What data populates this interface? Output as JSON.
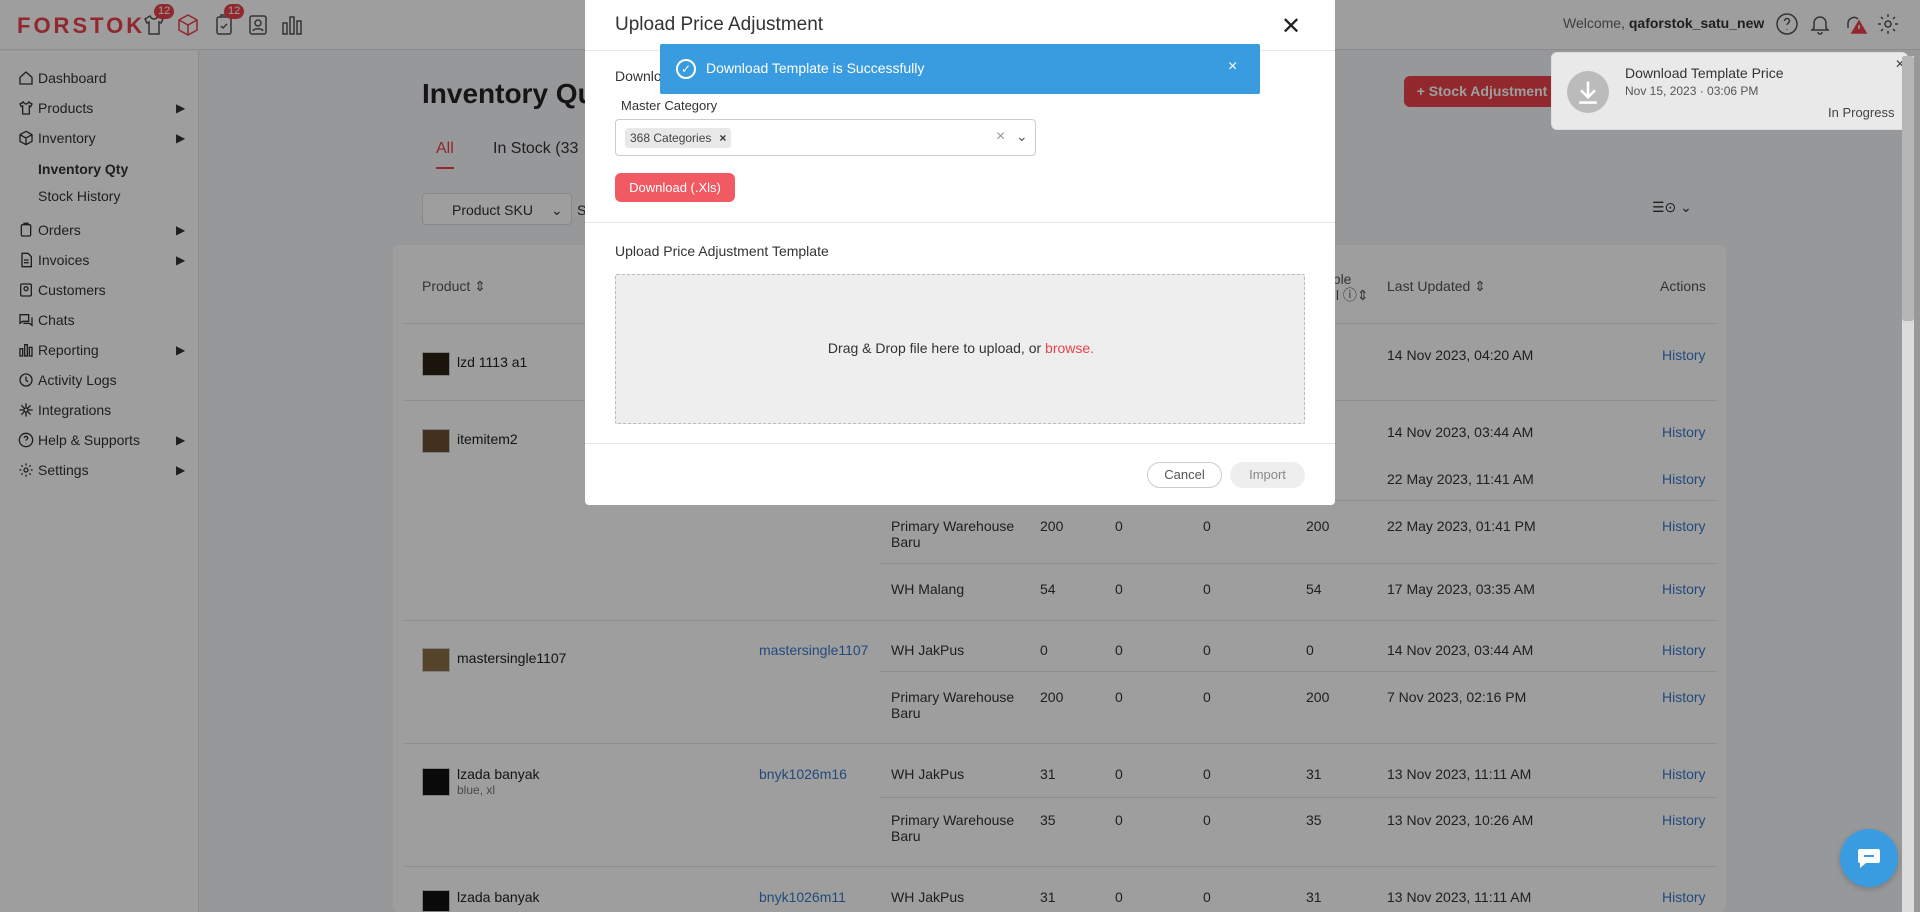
{
  "app": {
    "logo": "FORSTOK",
    "badge_count_1": "12",
    "badge_count_2": "12"
  },
  "header": {
    "welcome": "Welcome,",
    "username": "qaforstok_satu_new"
  },
  "sidebar": {
    "items": [
      {
        "label": "Dashboard",
        "icon": "home-icon"
      },
      {
        "label": "Products",
        "icon": "shirt-icon"
      },
      {
        "label": "Inventory",
        "icon": "box-icon"
      },
      {
        "label": "Orders",
        "icon": "clipboard-icon"
      },
      {
        "label": "Invoices",
        "icon": "document-icon"
      },
      {
        "label": "Customers",
        "icon": "contact-icon"
      },
      {
        "label": "Chats",
        "icon": "chat-icon"
      },
      {
        "label": "Reporting",
        "icon": "bar-chart-icon"
      },
      {
        "label": "Activity Logs",
        "icon": "history-icon"
      },
      {
        "label": "Integrations",
        "icon": "integration-icon"
      },
      {
        "label": "Help & Supports",
        "icon": "help-icon"
      },
      {
        "label": "Settings",
        "icon": "gear-icon"
      }
    ],
    "inventory_sub": [
      "Inventory Qty",
      "Stock History"
    ]
  },
  "page": {
    "title": "Inventory Qu",
    "tabs": [
      "All",
      "In Stock (33"
    ],
    "stock_button": "+ Stock Adjustment",
    "filter_label": "Product SKU",
    "filter_input": "S"
  },
  "table": {
    "headers": {
      "product": "Product ⇕",
      "available_line1": "able",
      "available_line2": "ell",
      "last_updated": "Last Updated ⇕",
      "actions": "Actions"
    },
    "history": "History",
    "rows": [
      {
        "name": "lzd 1113 a1",
        "date": "14 Nov 2023, 04:20 AM"
      },
      {
        "name": "itemitem2",
        "date": "14 Nov 2023, 03:44 AM"
      },
      {
        "date": "22 May 2023, 11:41 AM"
      },
      {
        "wh": "Primary Warehouse Baru",
        "q1": "200",
        "q2": "0",
        "q3": "0",
        "q4": "200",
        "date": "22 May 2023, 01:41 PM"
      },
      {
        "wh": "WH Malang",
        "q1": "54",
        "q2": "0",
        "q3": "0",
        "q4": "54",
        "date": "17 May 2023, 03:35 AM"
      },
      {
        "name": "mastersingle1107",
        "sku": "mastersingle1107",
        "wh": "WH JakPus",
        "q1": "0",
        "q2": "0",
        "q3": "0",
        "q4": "0",
        "date": "14 Nov 2023, 03:44 AM"
      },
      {
        "wh": "Primary Warehouse Baru",
        "q1": "200",
        "q2": "0",
        "q3": "0",
        "q4": "200",
        "date": "7 Nov 2023, 02:16 PM"
      },
      {
        "name": "lzada banyak",
        "variant": "blue, xl",
        "sku": "bnyk1026m16",
        "wh": "WH JakPus",
        "q1": "31",
        "q2": "0",
        "q3": "0",
        "q4": "31",
        "date": "13 Nov 2023, 11:11 AM"
      },
      {
        "wh": "Primary Warehouse Baru",
        "q1": "35",
        "q2": "0",
        "q3": "0",
        "q4": "35",
        "date": "13 Nov 2023, 10:26 AM"
      },
      {
        "name": "lzada banyak",
        "sku": "bnyk1026m11",
        "wh": "WH JakPus",
        "q1": "31",
        "q2": "0",
        "q3": "0",
        "q4": "31",
        "date": "13 Nov 2023, 11:11 AM"
      }
    ]
  },
  "modal": {
    "title": "Upload Price Adjustment",
    "download_label": "Downlo",
    "master_category_label": "Master Category",
    "chip": "368 Categories",
    "download_button": "Download (.Xls)",
    "upload_label": "Upload Price Adjustment Template",
    "dropzone_text": "Drag & Drop file here to upload, or ",
    "browse": "browse.",
    "cancel": "Cancel",
    "import": "Import"
  },
  "toast": {
    "message": "Download Template is Successfully"
  },
  "notification": {
    "title": "Download Template Price",
    "date": "Nov 15, 2023 · 03:06 PM",
    "status": "In Progress"
  },
  "colors": {
    "brand": "#e8424b",
    "info": "#3a9ce0",
    "link": "#3a78c8"
  }
}
